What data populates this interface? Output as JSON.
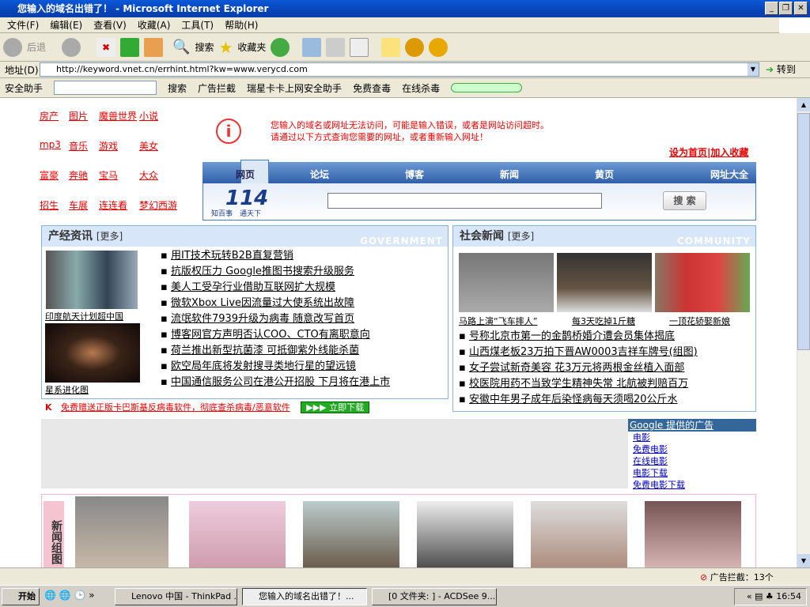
{
  "window": {
    "title": "您输入的域名出错了！ - Microsoft Internet Explorer"
  },
  "menu": [
    "文件(F)",
    "编辑(E)",
    "查看(V)",
    "收藏(A)",
    "工具(T)",
    "帮助(H)"
  ],
  "toolbar": {
    "back": "后退",
    "search": "搜索",
    "favorites": "收藏夹"
  },
  "address": {
    "label": "地址(D)",
    "url": "http://keyword.vnet.cn/errhint.html?kw=www.verycd.com",
    "go": "转到"
  },
  "toolbar2": [
    "安全助手",
    "搜索",
    "广告拦截",
    "瑞星卡卡上网安全助手",
    "免费查毒",
    "在线杀毒"
  ],
  "left_links": [
    [
      "房产",
      "图片",
      "魔兽世界",
      "小说"
    ],
    [
      "mp3",
      "音乐",
      "游戏",
      "美女"
    ],
    [
      "富豪",
      "奔驰",
      "宝马",
      "大众"
    ],
    [
      "招生",
      "车展",
      "连连看",
      "梦幻西游"
    ]
  ],
  "error": {
    "line1": "您输入的域名或网址无法访问，可能是输入错误，或者是网站访问超时。",
    "line2": "请通过以下方式查询您需要的网址，或者重新输入网址！"
  },
  "top_links": {
    "home": "设为首页",
    "fav": "加入收藏"
  },
  "tabs": [
    "网页",
    "论坛",
    "博客",
    "新闻",
    "黄页",
    "网址大全"
  ],
  "logo": {
    "num": "114",
    "slogan": "知百事　通天下"
  },
  "search": {
    "button": "搜 索",
    "value": ""
  },
  "panel_left": {
    "title": "产经资讯",
    "more": "[更多]",
    "en": "GOVERNMENT",
    "img1_caption": "印度航天计划超中国",
    "img2_caption": "星系进化图",
    "news": [
      "用IT技术玩转B2B直复营销",
      "抗版权压力 Google推图书搜索升级服务",
      "美人工受孕行业借助互联网扩大规模",
      "微软Xbox Live因流量过大使系统出故障",
      "流氓软件7939升级为病毒 随意改写首页",
      "博客网官方声明否认COO、CTO有离职意向",
      "荷兰推出新型抗菌漆 可抵御紫外线能杀菌",
      "欧空局年底将发射搜寻类地行星的望远镜",
      "中国通信服务公司在港公开招股 下月将在港上市"
    ]
  },
  "panel_right": {
    "title": "社会新闻",
    "more": "[更多]",
    "en": "COMMUNITY",
    "captions": [
      "马路上演“飞车摔人”",
      "每3天吃掉1斤糖",
      "一顶花轿娶新娘"
    ],
    "news": [
      "号称北京市第一的金鹊桥婚介遭会员集体揭底",
      "山西煤老板23万拍下晋AW0003吉祥车牌号(组图)",
      "女子尝试新奇美容 花3万元将两根金丝植入面部",
      "校医院用药不当致学生精神失常 北航被判赔百万",
      "安徽中年男子成年后染怪病每天须喝20公斤水"
    ]
  },
  "kaspersky": {
    "text": "免费赠送正版卡巴斯基反病毒软件，彻底查杀病毒/恶意软件",
    "button": "立即下载"
  },
  "google_ads": {
    "title": "Google 提供的广告",
    "links": [
      "电影",
      "免费电影",
      "在线电影",
      "电影下载",
      "免费电影下载"
    ]
  },
  "photo_strip": {
    "label": "新闻组图"
  },
  "status": {
    "popup_block": "广告拦截：13个"
  },
  "taskbar": {
    "start": "开始",
    "tasks": [
      "Lenovo 中国 - ThinkPad ...",
      "您输入的域名出错了！...",
      "[0 文件夹: ] - ACDSee 9..."
    ],
    "clock": "16:54"
  }
}
